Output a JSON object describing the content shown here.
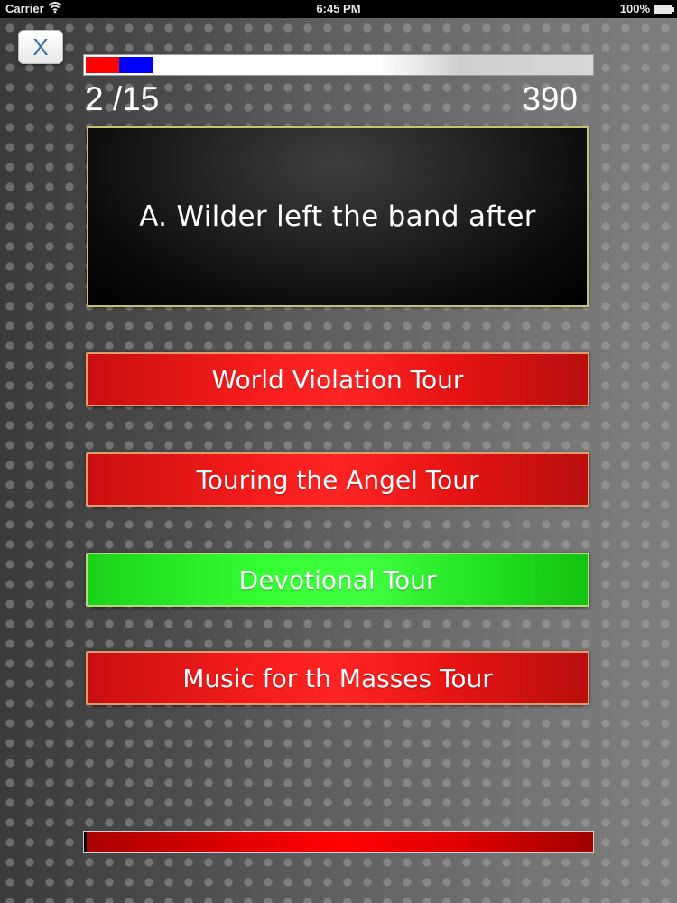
{
  "status_bar": {
    "carrier": "Carrier",
    "time": "6:45 PM",
    "battery": "100%"
  },
  "quiz": {
    "close_label": "X",
    "counter": "2 /15",
    "score": "390",
    "progress": {
      "answered": 2,
      "total": 15,
      "segment_colors": [
        "#ff0000",
        "#0000ff"
      ]
    },
    "question": "A. Wilder left the band after",
    "answers": [
      {
        "label": "World Violation Tour",
        "state": "wrong",
        "color": "#ff2424"
      },
      {
        "label": "Touring the Angel Tour",
        "state": "wrong",
        "color": "#ff2424"
      },
      {
        "label": "Devotional Tour",
        "state": "correct",
        "color": "#33ff33"
      },
      {
        "label": "Music for th Masses Tour",
        "state": "wrong",
        "color": "#ff2424"
      }
    ],
    "timer": {
      "color": "#ff0000",
      "fraction_remaining": 1.0
    }
  }
}
